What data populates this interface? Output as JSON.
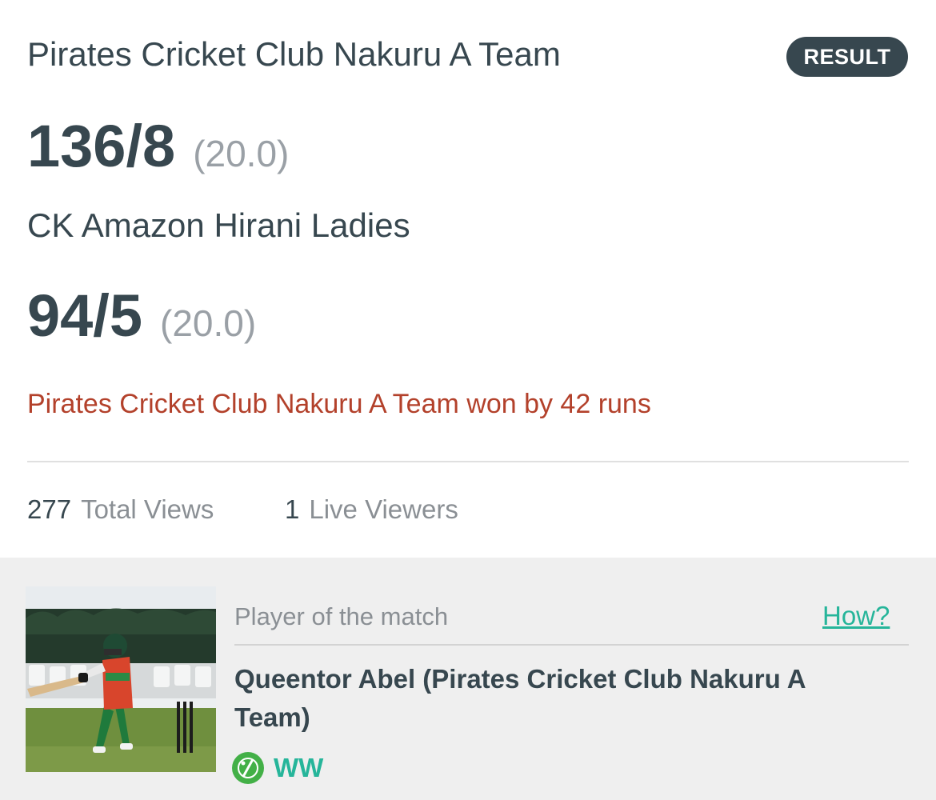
{
  "match": {
    "team1": {
      "name": "Pirates Cricket Club Nakuru A Team",
      "score": "136/8",
      "overs": "(20.0)"
    },
    "team2": {
      "name": "CK Amazon Hirani Ladies",
      "score": "94/5",
      "overs": "(20.0)"
    },
    "status_badge": "RESULT",
    "result_text": "Pirates Cricket Club Nakuru A Team won by 42 runs"
  },
  "stats": {
    "total_views": {
      "value": "277",
      "label": "Total Views"
    },
    "live_viewers": {
      "value": "1",
      "label": "Live Viewers"
    }
  },
  "player_of_match": {
    "label": "Player of the match",
    "how_link": "How?",
    "name": "Queentor Abel (Pirates Cricket Club Nakuru A Team)",
    "role_icon": "bowler-ball-icon",
    "role": "WW"
  },
  "colors": {
    "text_dark": "#37474f",
    "text_muted": "#9aa0a6",
    "result_red": "#b3412b",
    "link_green": "#26b59a",
    "role_green": "#43b047",
    "panel_gray": "#efefef"
  }
}
